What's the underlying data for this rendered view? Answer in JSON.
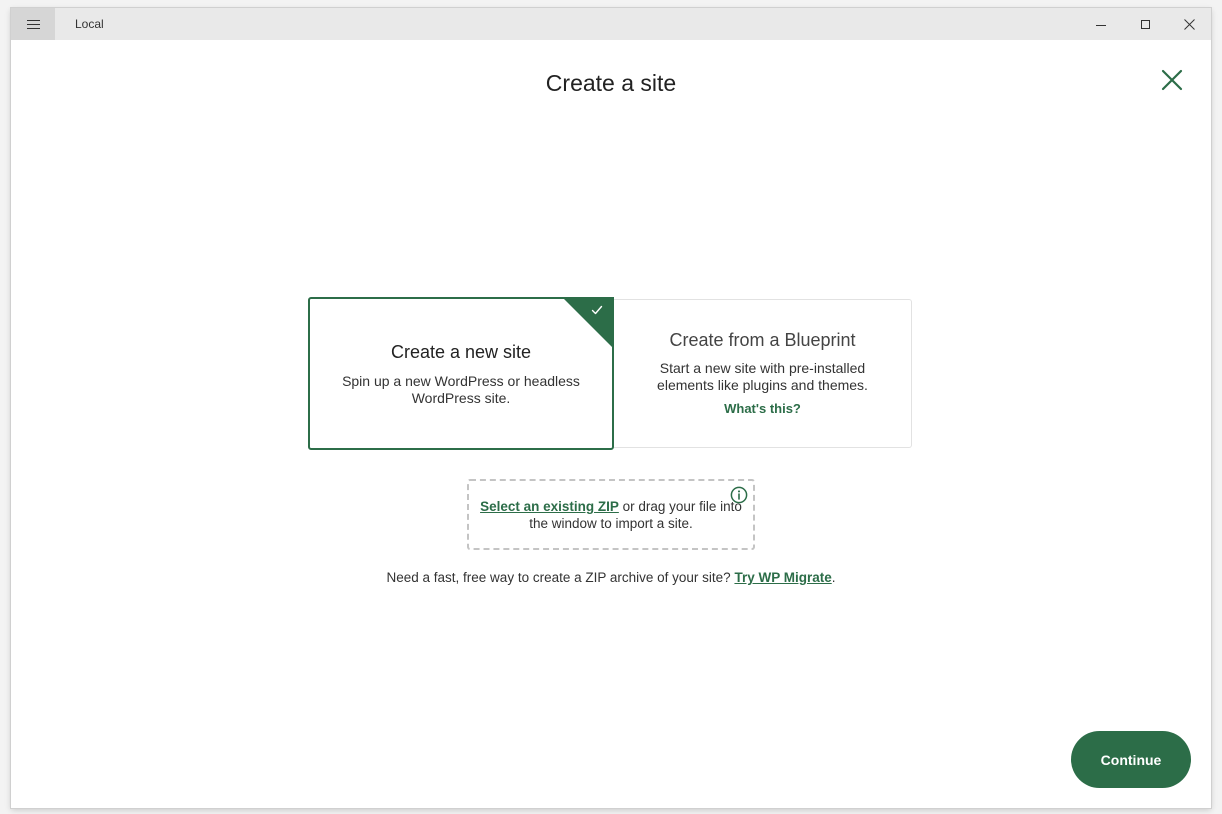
{
  "app": {
    "title": "Local"
  },
  "page": {
    "title": "Create a site"
  },
  "cards": {
    "new_site": {
      "title": "Create a new site",
      "description": "Spin up a new WordPress or headless WordPress site.",
      "selected": true
    },
    "blueprint": {
      "title": "Create from a Blueprint",
      "description": "Start a new site with pre-installed elements like plugins and themes.",
      "link": "What's this?"
    }
  },
  "import": {
    "link": "Select an existing ZIP",
    "text": "or drag your file into the window to import a site."
  },
  "migrate": {
    "text": "Need a fast, free way to create a ZIP archive of your site?",
    "link": "Try WP Migrate",
    "suffix": "."
  },
  "actions": {
    "continue_label": "Continue"
  },
  "icons": {
    "menu": "hamburger-icon",
    "minimize": "minimize-icon",
    "maximize": "maximize-icon",
    "window_close": "window-close-icon",
    "close": "close-icon",
    "check": "checkmark-icon",
    "info": "info-icon"
  },
  "colors": {
    "accent": "#2c6d48",
    "titlebar": "#e9e9e9",
    "dashed_border": "#c4c4c4"
  }
}
